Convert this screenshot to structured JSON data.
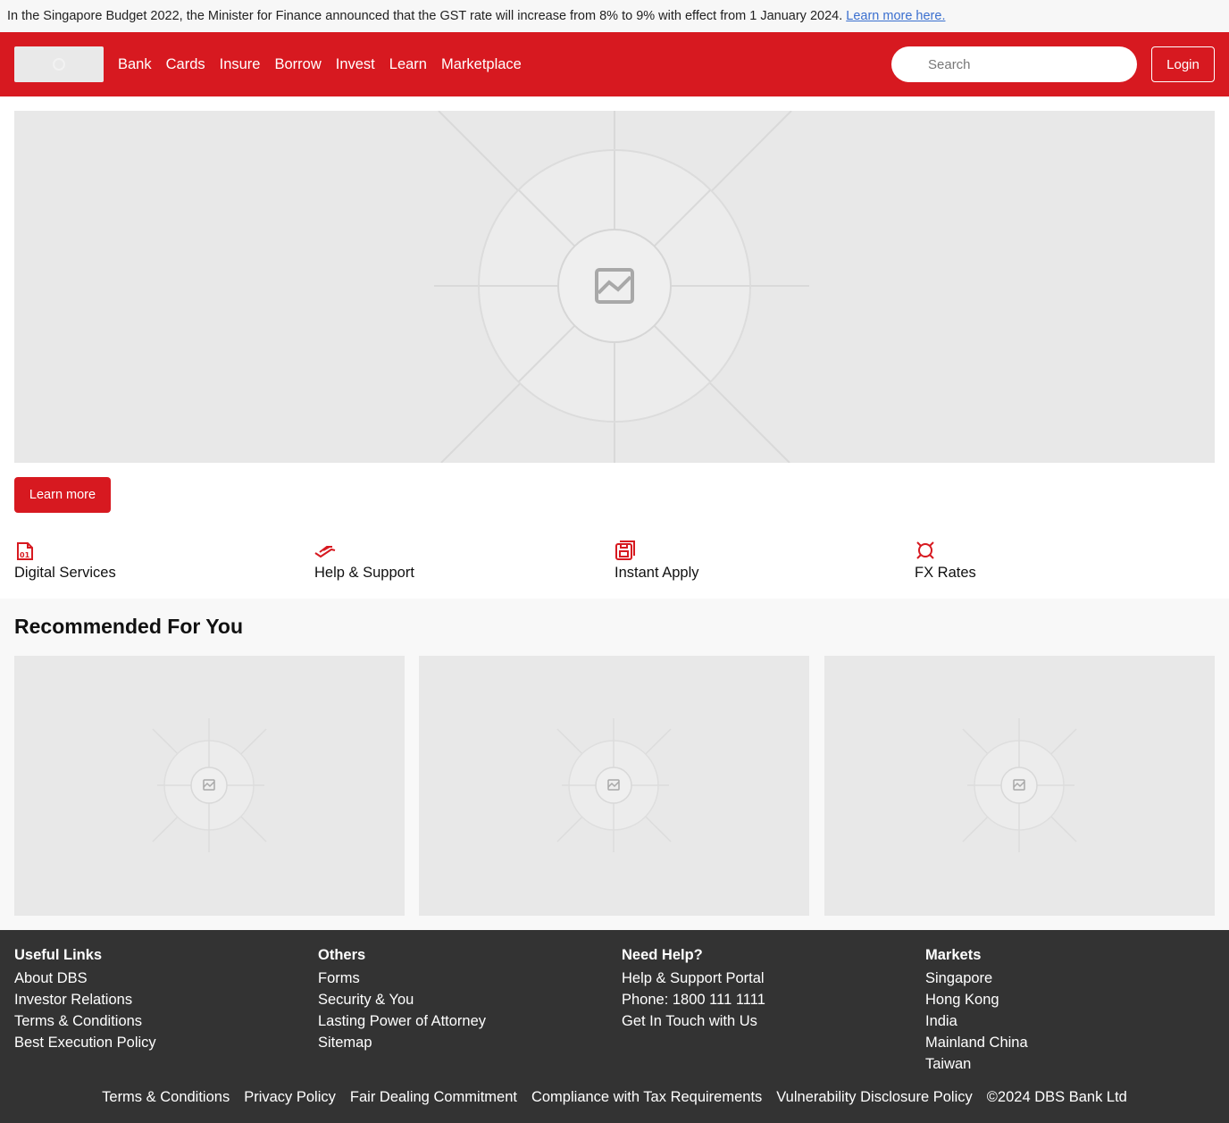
{
  "announcement": {
    "text": "In the Singapore Budget 2022, the Minister for Finance announced that the GST rate will increase from 8% to 9% with effect from 1 January 2024.",
    "link": "Learn more here."
  },
  "header": {
    "nav": [
      "Bank",
      "Cards",
      "Insure",
      "Borrow",
      "Invest",
      "Learn",
      "Marketplace"
    ],
    "search_placeholder": "Search",
    "login_label": "Login",
    "brand_color": "#d71920"
  },
  "hero": {
    "button_label": "Learn more",
    "image_icon": "image-placeholder-icon"
  },
  "quick_links": [
    {
      "label": "Digital Services",
      "icon": "digital-file-icon"
    },
    {
      "label": "Help & Support",
      "icon": "handshake-icon"
    },
    {
      "label": "Instant Apply",
      "icon": "save-stack-icon"
    },
    {
      "label": "FX Rates",
      "icon": "currency-icon"
    }
  ],
  "recommended": {
    "title": "Recommended For You",
    "cards": [
      {
        "icon": "image-placeholder-icon"
      },
      {
        "icon": "image-placeholder-icon"
      },
      {
        "icon": "image-placeholder-icon"
      }
    ]
  },
  "footer": {
    "columns": [
      {
        "title": "Useful Links",
        "links": [
          "About DBS",
          "Investor Relations",
          "Terms & Conditions",
          "Best Execution Policy"
        ]
      },
      {
        "title": "Others",
        "links": [
          "Forms",
          "Security & You",
          "Lasting Power of Attorney",
          "Sitemap"
        ]
      },
      {
        "title": "Need Help?",
        "links": [
          "Help & Support Portal",
          "Phone: 1800 111 1111",
          "Get In Touch with Us"
        ]
      },
      {
        "title": "Markets",
        "links": [
          "Singapore",
          "Hong Kong",
          "India",
          "Mainland China",
          "Taiwan"
        ]
      }
    ],
    "bottom_links": [
      "Terms & Conditions",
      "Privacy Policy",
      "Fair Dealing Commitment",
      "Compliance with Tax Requirements",
      "Vulnerability Disclosure Policy"
    ],
    "copyright": "©2024 DBS Bank Ltd"
  }
}
